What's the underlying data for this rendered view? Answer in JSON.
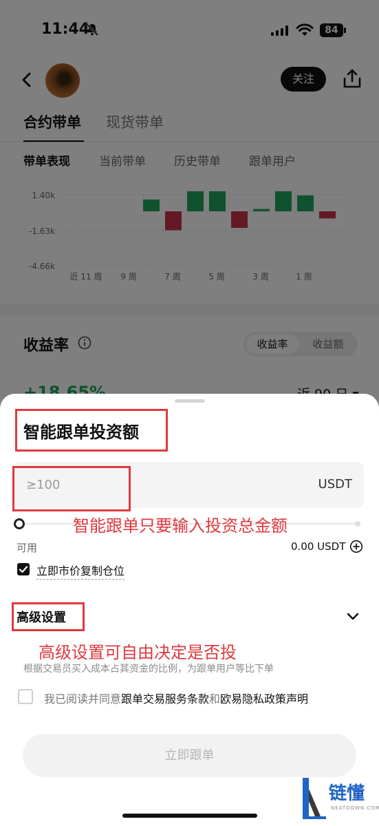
{
  "status_bar": {
    "time": "11:44",
    "battery": "84"
  },
  "header": {
    "follow_label": "关注"
  },
  "main_tabs": [
    {
      "label": "合约带单"
    },
    {
      "label": "现货带单"
    }
  ],
  "sub_tabs": [
    {
      "label": "带单表现"
    },
    {
      "label": "当前带单"
    },
    {
      "label": "历史带单"
    },
    {
      "label": "跟单用户"
    }
  ],
  "chart_data": {
    "type": "bar",
    "y_ticks": [
      "1.40k",
      "-1.63k",
      "-4.66k"
    ],
    "x_labels": [
      "近 11 周",
      "9 周",
      "7 周",
      "5 周",
      "3 周",
      "1 周"
    ],
    "values": [
      1000,
      -1600,
      1700,
      1700,
      -1400,
      200,
      1700,
      1350,
      -600
    ],
    "ylim": [
      -4660,
      1900
    ],
    "colors": {
      "up": "#22a45d",
      "down": "#c8354a"
    }
  },
  "yield_section": {
    "title": "收益率",
    "segments": [
      "收益率",
      "收益额"
    ],
    "value": "+18.65%",
    "period": "近 90 日 ▾"
  },
  "sheet": {
    "title": "智能跟单投资额",
    "amount_placeholder": "≥100",
    "unit": "USDT",
    "available_label": "可用",
    "available_value": "0.00 USDT",
    "copy_position_label": "立即市价复制仓位",
    "advanced_title": "高级设置",
    "advanced_desc": "根据交易员买入成本占其资金的比例，为跟单用户等比下单",
    "agree_prefix": "我已阅读并同意",
    "terms_link": "跟单交易服务条款",
    "agree_and": "和",
    "privacy_link": "欧易隐私政策声明",
    "submit_label": "立即跟单"
  },
  "annotations": {
    "note1": "智能跟单只要输入投资总金额",
    "note2": "高级设置可自由决定是否投"
  },
  "watermark": {
    "text": "链懂",
    "sub": "NEATDOWN.COM"
  }
}
